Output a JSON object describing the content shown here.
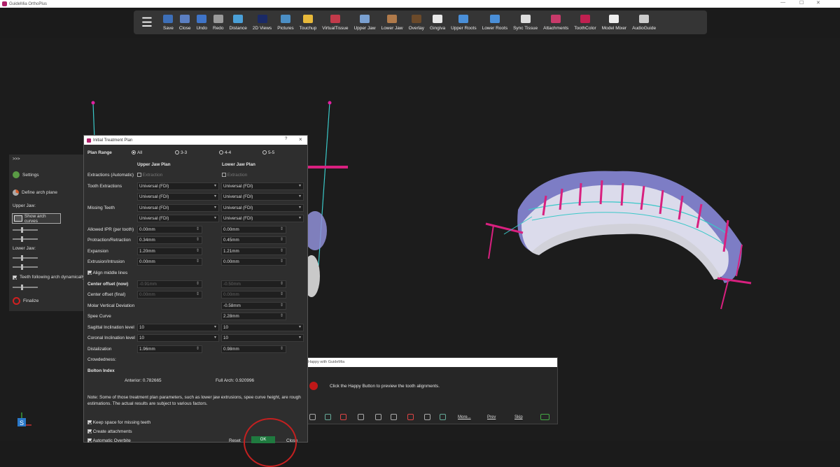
{
  "app": {
    "title": "GuideMia OrthoPlus"
  },
  "toolbar": {
    "items": [
      {
        "label": "Save",
        "color": "#3d6fb8"
      },
      {
        "label": "Close",
        "color": "#5b7fc2"
      },
      {
        "label": "Undo",
        "color": "#3f74c8"
      },
      {
        "label": "Redo",
        "color": "#9a9a9a"
      },
      {
        "label": "Distance",
        "color": "#4aa0d8"
      },
      {
        "label": "2D Views",
        "color": "#1a2a66"
      },
      {
        "label": "Pictures",
        "color": "#4b8ec4"
      },
      {
        "label": "Touchup",
        "color": "#e8b93a"
      },
      {
        "label": "VirtualTissue",
        "color": "#c23a4a"
      },
      {
        "label": "Upper Jaw",
        "color": "#7aa0d0"
      },
      {
        "label": "Lower Jaw",
        "color": "#b07a4a"
      },
      {
        "label": "Overlay",
        "color": "#6b4a2a"
      },
      {
        "label": "Gingiva",
        "color": "#e8e8e8"
      },
      {
        "label": "Upper Roots",
        "color": "#4a8fd8"
      },
      {
        "label": "Lower Roots",
        "color": "#4a8fd8"
      },
      {
        "label": "Sync Tissue",
        "color": "#dddddd"
      },
      {
        "label": "Attachments",
        "color": "#c83a6a"
      },
      {
        "label": "ToothColor",
        "color": "#c02050"
      },
      {
        "label": "Model Mixer",
        "color": "#eeeeee"
      },
      {
        "label": "AudioGuide",
        "color": "#cccccc"
      }
    ]
  },
  "sidebar": {
    "collapse": ">>>",
    "settings": "Settings",
    "define_arch": "Define arch plane",
    "upper_jaw": "Upper Jaw:",
    "show_arch": "Show arch curves",
    "lower_jaw": "Lower Jaw:",
    "teeth_following": "Teeth following arch dynamically",
    "finalize": "Finalize"
  },
  "dialog": {
    "title": "Initial Treatment Plan",
    "help": "?",
    "close": "×",
    "plan_range": "Plan Range",
    "ranges": [
      "All",
      "3-3",
      "4-4",
      "5-5"
    ],
    "upper_header": "Upper Jaw Plan",
    "lower_header": "Lower Jaw Plan",
    "extractions_auto": "Extractions (Automatic)",
    "extraction": "Extraction",
    "tooth_extractions": "Tooth Extractions",
    "missing_teeth": "Missing Teeth",
    "universal": "Universal (FDI)",
    "rows": [
      {
        "label": "Allowed IPR (per tooth)",
        "upper": "0.00mm",
        "lower": "0.00mm"
      },
      {
        "label": "Protraction/Retraction",
        "upper": "0.34mm",
        "lower": "0.45mm"
      },
      {
        "label": "Expansion",
        "upper": "1.20mm",
        "lower": "1.21mm"
      },
      {
        "label": "Extrusion/Intrusion",
        "upper": "0.00mm",
        "lower": "0.00mm"
      }
    ],
    "align_middle": "Align middle lines",
    "center_now": "Center offset (now)",
    "center_now_upper": "-0.91mm",
    "center_now_lower": "-0.50mm",
    "center_final": "Center offset (final)",
    "center_final_upper": "0.00mm",
    "center_final_lower": "0.00mm",
    "molar_vertical": "Molar Vertical Deviation",
    "molar_vertical_lower": "-0.58mm",
    "spee_curve": "Spee Curve",
    "spee_curve_lower": "2.28mm",
    "sagittal": "Sagittal Inclination level",
    "sagittal_upper": "10",
    "sagittal_lower": "10",
    "coronal": "Coronal Inclination level",
    "coronal_upper": "10",
    "coronal_lower": "10",
    "distalization": "Distalization",
    "distalization_upper": "1.96mm",
    "distalization_lower": "0.98mm",
    "crowdedness": "Crowdedness:",
    "bolton_index": "Bolton Index",
    "anterior": "Anterior: 0.782665",
    "full_arch": "Full Arch: 0.920996",
    "note": "Note: Some of those treatment plan parameters, such as lower jaw extrusions, spee curve height, are rough estimations. The actual results are subject to various factors.",
    "keep_space": "Keep space for missing teeth",
    "create_attachments": "Create attachments",
    "automatic_overbite": "Automatic Overbite",
    "reset": "Reset",
    "ok": "OK",
    "close_btn": "Close"
  },
  "happy": {
    "title": "Happy with GuideMia",
    "message": "Click the Happy Button to preview the tooth alignments.",
    "more": "More...",
    "prev": "Prev",
    "skip": "Skip"
  }
}
